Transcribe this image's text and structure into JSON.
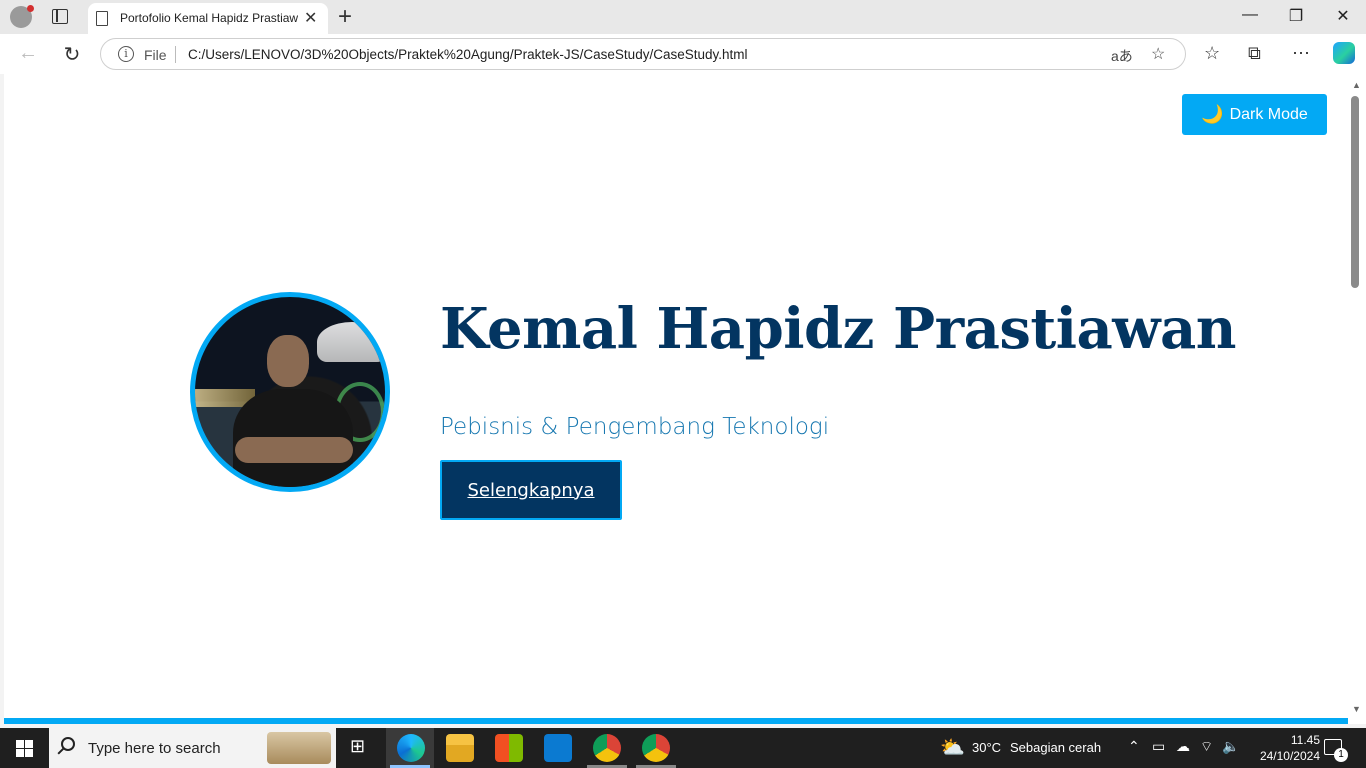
{
  "browser": {
    "tab_title": "Portofolio Kemal Hapidz Prastiawan",
    "tab_close": "✕",
    "new_tab": "+",
    "address_scheme": "File",
    "address_url": "C:/Users/LENOVO/3D%20Objects/Praktek%20Agung/Praktek-JS/CaseStudy/CaseStudy.html",
    "window_controls": [
      "—",
      "❐",
      "✕"
    ]
  },
  "page": {
    "dark_mode_icon": "🌙",
    "dark_mode_label": "Dark Mode",
    "name": "Kemal Hapidz Prastiawan",
    "subtitle": "Pebisnis & Pengembang Teknologi",
    "cta_label": "Selengkapnya"
  },
  "taskbar": {
    "search_placeholder": "Type here to search",
    "weather_temp": "30°C",
    "weather_desc": "Sebagian cerah",
    "time": "11.45",
    "date": "24/10/2024",
    "notifications": "1"
  },
  "colors": {
    "accent": "#03a9f4",
    "navy": "#033561",
    "subtitle": "#1677b0"
  }
}
